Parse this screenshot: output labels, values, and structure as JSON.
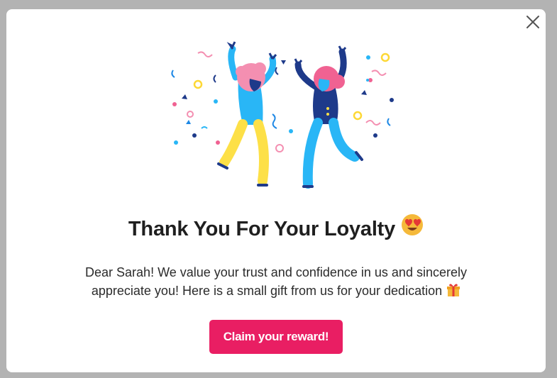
{
  "dialog": {
    "title": "Thank You For Your Loyalty",
    "title_emoji": "heart-eyes-emoji",
    "message": "Dear Sarah! We value your trust and confidence in us and sincerely appreciate you! Here is a small gift from us for your dedication",
    "message_emoji": "gift-emoji",
    "cta_label": "Claim your reward!",
    "close_icon": "close-icon",
    "illustration": "celebrating-people-illustration"
  },
  "colors": {
    "overlay": "#b3b3b3",
    "card": "#ffffff",
    "cta": "#e91e63",
    "cta_text": "#ffffff",
    "text": "#1f1f1f"
  }
}
